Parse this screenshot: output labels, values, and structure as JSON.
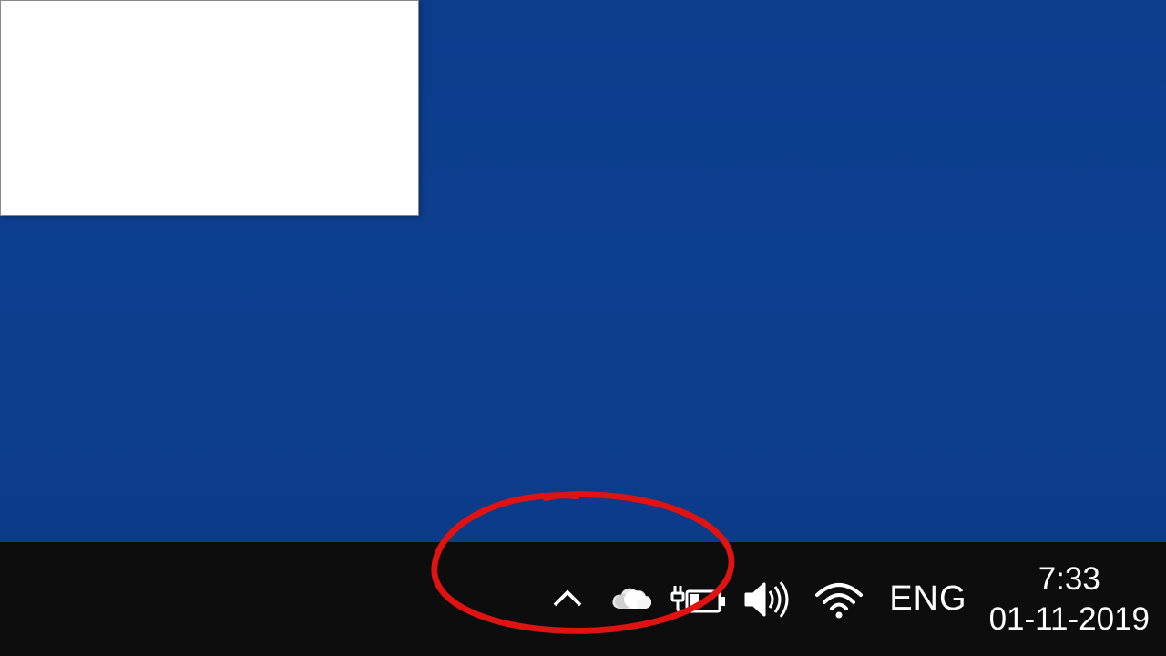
{
  "systray": {
    "language": "ENG",
    "time": "7:33",
    "date": "01-11-2019"
  },
  "icons": {
    "chevron_up": "chevron-up-icon",
    "onedrive": "onedrive-cloud-icon",
    "battery": "battery-charging-icon",
    "volume": "volume-icon",
    "wifi": "wifi-icon"
  },
  "annotation": {
    "type": "red-circle",
    "target": "system-tray-icons"
  }
}
